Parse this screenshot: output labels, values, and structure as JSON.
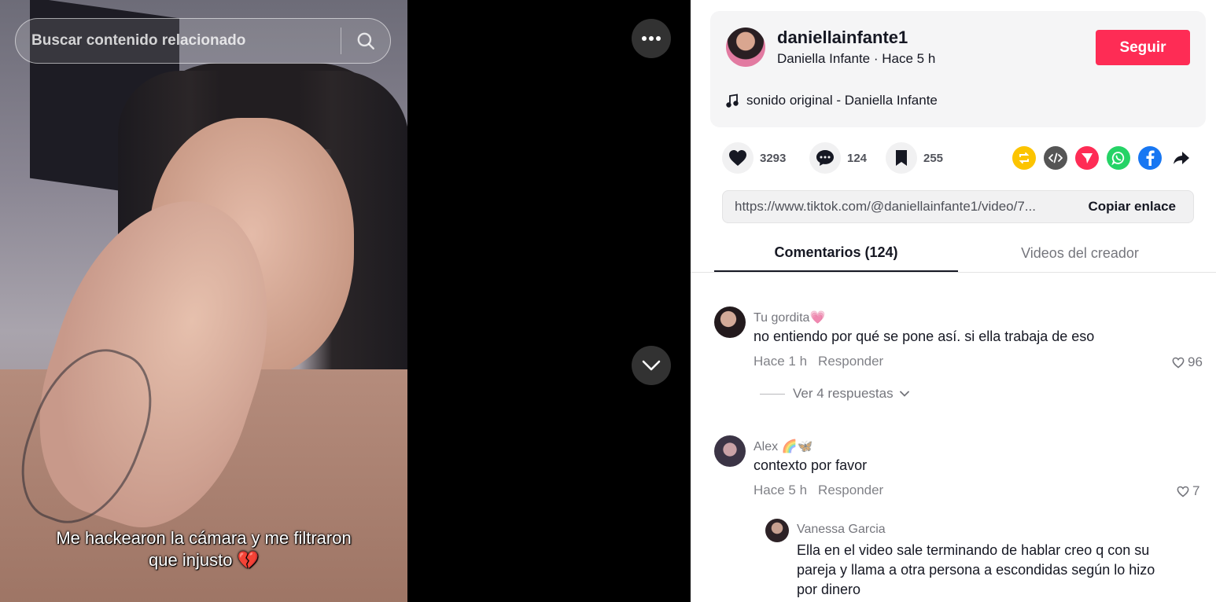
{
  "video": {
    "search_placeholder": "Buscar contenido relacionado",
    "caption": "Me hackearon la cámara y me filtraron que injusto 💔"
  },
  "author": {
    "username": "daniellainfante1",
    "display_name_and_time": "Daniella Infante · Hace 5 h",
    "follow_label": "Seguir",
    "music": "sonido original - Daniella Infante"
  },
  "stats": {
    "likes": "3293",
    "comments": "124",
    "saves": "255"
  },
  "share": {
    "icons": [
      "repost-icon",
      "embed-icon",
      "send-icon",
      "whatsapp-icon",
      "facebook-icon",
      "share-arrow-icon"
    ],
    "link": "https://www.tiktok.com/@daniellainfante1/video/7...",
    "copy_label": "Copiar enlace"
  },
  "tabs": {
    "comments": "Comentarios (124)",
    "creator_videos": "Videos del creador"
  },
  "comments": [
    {
      "user": "Tu gordita💗",
      "text": "no entiendo por qué se pone así. si ella trabaja de eso",
      "time": "Hace 1 h",
      "reply_label": "Responder",
      "likes": "96"
    },
    {
      "user": "Alex 🌈🦋",
      "text": "contexto por favor",
      "time": "Hace 5 h",
      "reply_label": "Responder",
      "likes": "7"
    }
  ],
  "view_replies_label": "Ver 4 respuestas",
  "replies": [
    {
      "user": "Vanessa Garcia",
      "text": "Ella en el video sale terminando de hablar creo q con su pareja y llama a otra persona a escondidas según lo hizo por dinero"
    }
  ],
  "colors": {
    "follow": "#fe2c55",
    "repost": "#fcc400",
    "embed": "#555555",
    "send": "#fe2c55",
    "whatsapp": "#25d366",
    "facebook": "#1877f2"
  }
}
